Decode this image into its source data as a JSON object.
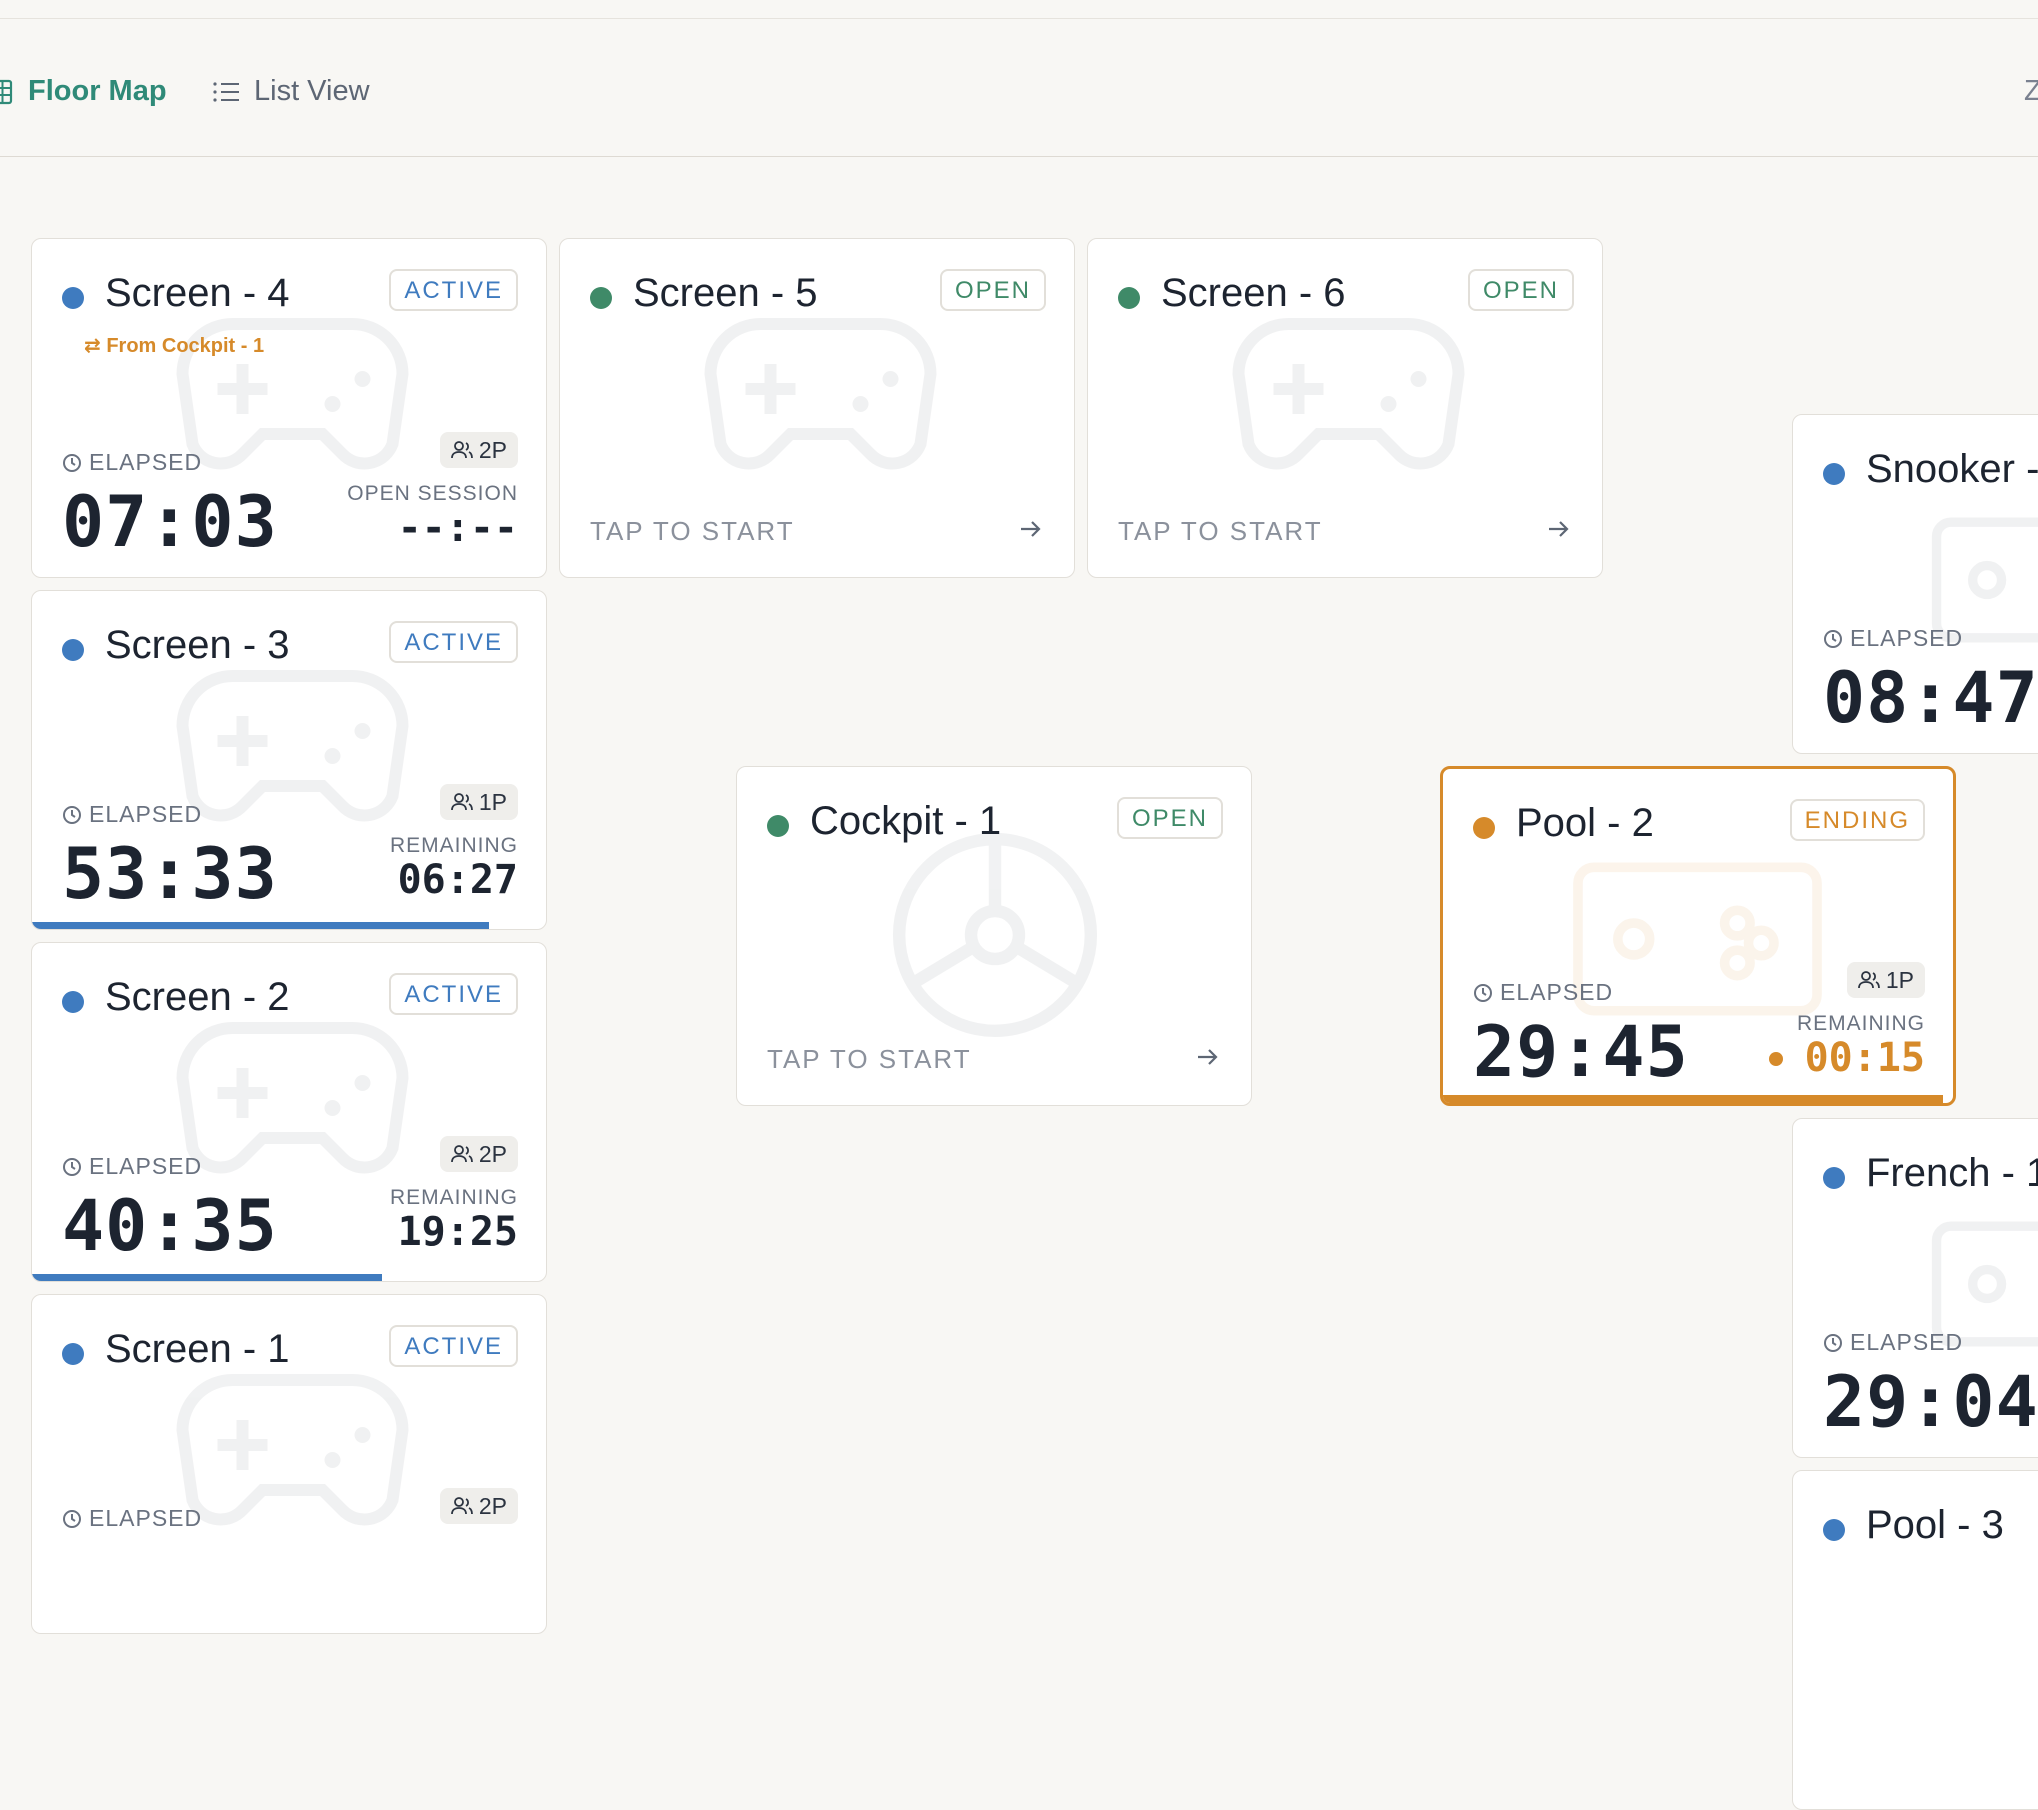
{
  "toolbar": {
    "tabs": [
      {
        "label": "Floor Map",
        "icon": "grid-icon",
        "active": true
      },
      {
        "label": "List View",
        "icon": "list-icon",
        "active": false
      }
    ],
    "edge_glyph": "Z"
  },
  "colors": {
    "active": "#3f7bbf",
    "open": "#3f8a68",
    "ending": "#d68a2a"
  },
  "labels": {
    "elapsed": "ELAPSED",
    "remaining": "REMAINING",
    "open_session": "OPEN SESSION",
    "tap_to_start": "TAP TO START"
  },
  "stations": [
    {
      "title": "Screen - 4",
      "status": "ACTIVE",
      "transfer": "⇄ From Cockpit - 1",
      "elapsed": "07:03",
      "players": "2P",
      "remaining_label": "OPEN SESSION",
      "remaining": "--:--"
    },
    {
      "title": "Screen - 5",
      "status": "OPEN",
      "action": "TAP TO START"
    },
    {
      "title": "Screen - 6",
      "status": "OPEN",
      "action": "TAP TO START"
    },
    {
      "title": "Screen - 3",
      "status": "ACTIVE",
      "elapsed": "53:33",
      "players": "1P",
      "remaining_label": "REMAINING",
      "remaining": "06:27",
      "progress": 0.89
    },
    {
      "title": "Screen - 2",
      "status": "ACTIVE",
      "elapsed": "40:35",
      "players": "2P",
      "remaining_label": "REMAINING",
      "remaining": "19:25",
      "progress": 0.68
    },
    {
      "title": "Screen - 1",
      "status": "ACTIVE",
      "elapsed": "ELAPSED",
      "players": "2P"
    },
    {
      "title": "Cockpit - 1",
      "status": "OPEN",
      "action": "TAP TO START"
    },
    {
      "title": "Pool - 2",
      "status": "ENDING",
      "elapsed": "29:45",
      "players": "1P",
      "remaining_label": "REMAINING",
      "remaining": "00:15",
      "progress": 0.98
    },
    {
      "title": "Snooker -",
      "elapsed": "08:47"
    },
    {
      "title": "French - 1",
      "elapsed": "29:04"
    },
    {
      "title": "Pool - 3"
    }
  ]
}
